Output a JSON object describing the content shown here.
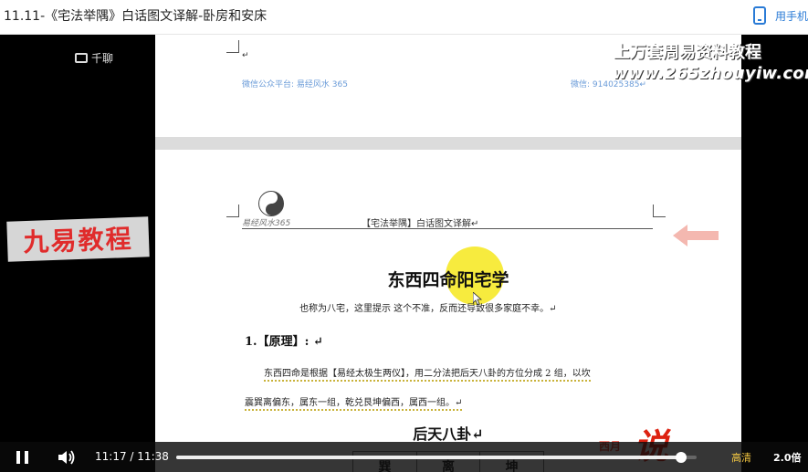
{
  "header": {
    "title": "11.11-《宅法举隅》白话图文译解-卧房和安床",
    "phone_label": "用手机"
  },
  "overlay": {
    "brand": "千聊",
    "ad_line1": "上万套周易资料教程",
    "ad_line2": "www.265zhouyiw.com",
    "side_logo": "九易教程",
    "stamp_small": "西月",
    "stamp_big": "说"
  },
  "document": {
    "page1": {
      "mark": "↵",
      "left_note": "微信公众平台: 易经风水 365",
      "right_note": "微信: 914025385↵"
    },
    "page2": {
      "header_left": "易经风水365",
      "header_center": "【宅法举隅】白话图文译解↵",
      "title": "东西四命阳宅学",
      "subtitle": "也称为八宅，这里提示 这个不准，反而还导致很多家庭不幸。↵",
      "section": "1.【原理】: ↵",
      "body_line1": "东西四命是根据【易经太极生两仪】，用二分法把后天八卦的方位分成 2 组，以坎",
      "body_line2": "震巽离偏东，属东一组，乾兑艮坤偏西，属西一组。↵",
      "subheading": "后天八卦↵",
      "table_cells": [
        "巽",
        "离",
        "坤"
      ]
    }
  },
  "player": {
    "current_time": "11:17",
    "separator": "/",
    "duration": "11:38",
    "progress": 0.97,
    "quality": "高清",
    "speed": "2.0倍",
    "colors": {
      "accent": "#f5c842",
      "link": "#2a7bd6"
    }
  }
}
